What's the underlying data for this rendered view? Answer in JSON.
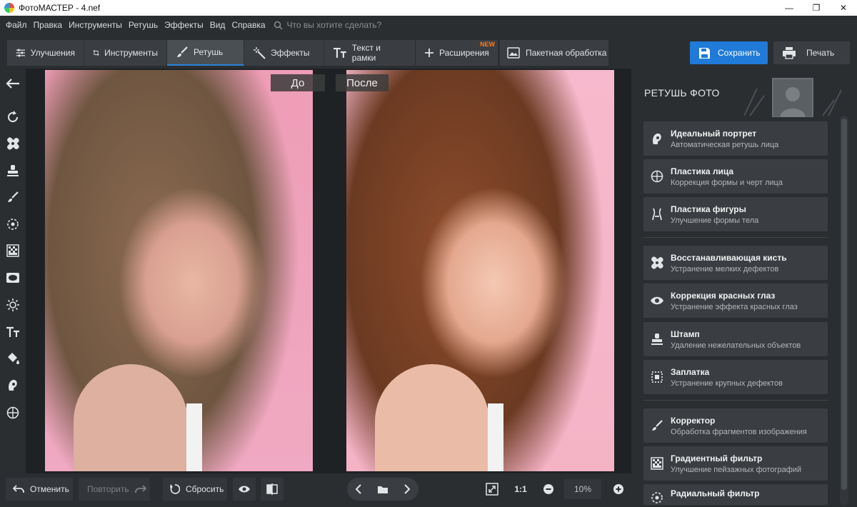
{
  "window": {
    "title": "ФотоМАСТЕР - 4.nef",
    "controls": [
      "—",
      "❐",
      "✕"
    ]
  },
  "menu": {
    "items": [
      "Файл",
      "Правка",
      "Инструменты",
      "Ретушь",
      "Эффекты",
      "Вид",
      "Справка"
    ],
    "search_placeholder": "Что вы хотите сделать?"
  },
  "toolbar": {
    "tabs": [
      {
        "label": "Улучшения",
        "icon": "sliders-icon"
      },
      {
        "label": "Инструменты",
        "icon": "crop-icon"
      },
      {
        "label": "Ретушь",
        "icon": "brush-icon",
        "active": true
      },
      {
        "label": "Эффекты",
        "icon": "magic-wand-icon"
      },
      {
        "label": "Текст и рамки",
        "icon": "text-icon"
      },
      {
        "label": "Расширения",
        "icon": "plus-icon",
        "badge": "NEW"
      }
    ],
    "batch_label": "Пакетная обработка",
    "save_label": "Сохранить",
    "print_label": "Печать",
    "accent": "#1f7ad8"
  },
  "canvas": {
    "before_label": "До",
    "after_label": "После"
  },
  "right_panel": {
    "title": "РЕТУШЬ ФОТО",
    "tools": [
      {
        "name": "Идеальный портрет",
        "desc": "Автоматическая ретушь лица",
        "icon": "portrait-icon"
      },
      {
        "name": "Пластика лица",
        "desc": "Коррекция формы и черт лица",
        "icon": "face-target-icon"
      },
      {
        "name": "Пластика фигуры",
        "desc": "Улучшение формы тела",
        "icon": "figure-icon"
      },
      {
        "name": "Восстанавливающая кисть",
        "desc": "Устранение мелких дефектов",
        "icon": "bandage-icon"
      },
      {
        "name": "Коррекция красных глаз",
        "desc": "Устранение эффекта красных глаз",
        "icon": "eye-icon"
      },
      {
        "name": "Штамп",
        "desc": "Удаление нежелательных объектов",
        "icon": "stamp-icon"
      },
      {
        "name": "Заплатка",
        "desc": "Устранение крупных дефектов",
        "icon": "patch-icon"
      },
      {
        "name": "Корректор",
        "desc": "Обработка фрагментов изображения",
        "icon": "brush-icon"
      },
      {
        "name": "Градиентный фильтр",
        "desc": "Улучшение пейзажных фотографий",
        "icon": "gradient-icon"
      },
      {
        "name": "Радиальный фильтр",
        "desc": "",
        "icon": "radial-icon"
      }
    ]
  },
  "bottom": {
    "undo_label": "Отменить",
    "redo_label": "Повторить",
    "reset_label": "Сбросить",
    "one_to_one": "1:1",
    "zoom_value": "10%"
  }
}
